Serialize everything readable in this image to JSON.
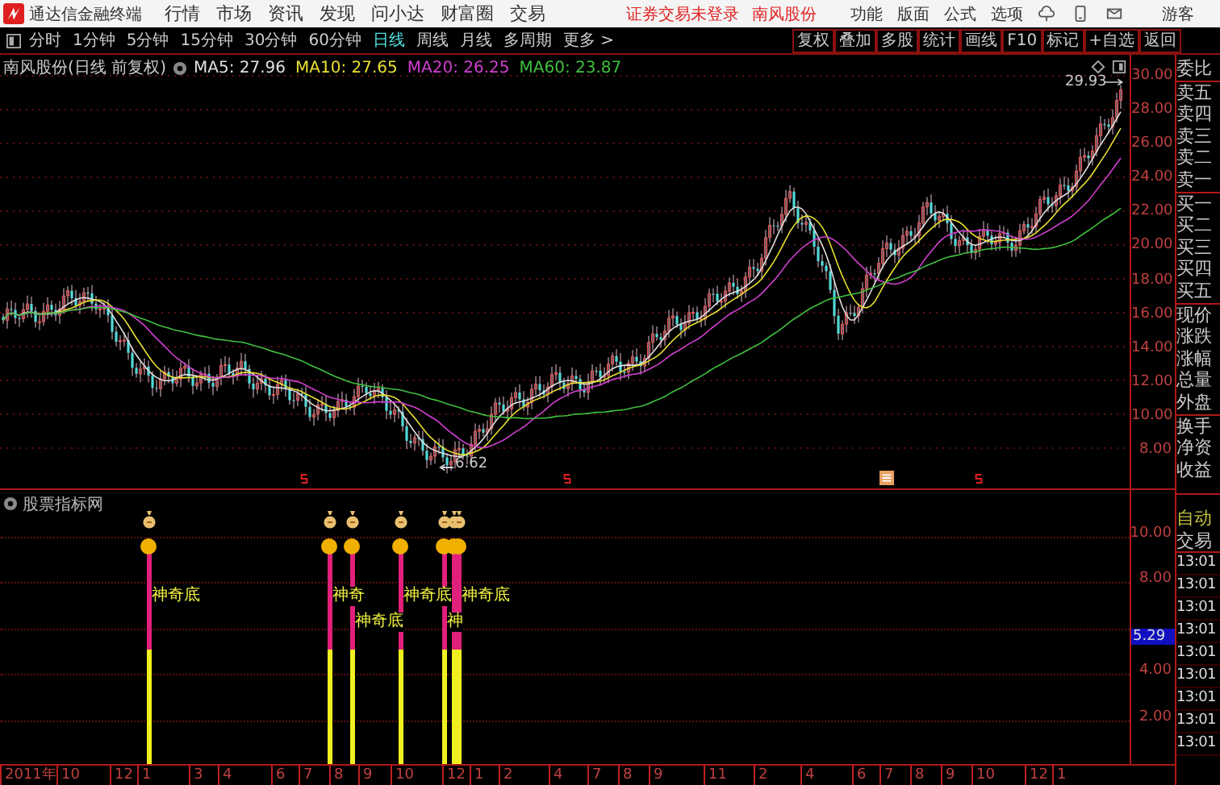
{
  "title_bar": {
    "app_name": "通达信金融终端",
    "menu": [
      "行情",
      "市场",
      "资讯",
      "发现",
      "问小达",
      "财富圈",
      "交易"
    ],
    "login_status": "证券交易未登录",
    "stock_name": "南风股份",
    "right_menu": [
      "功能",
      "版面",
      "公式",
      "选项"
    ],
    "user": "游客"
  },
  "toolbar": {
    "periods": [
      {
        "label": "分时",
        "selected": false
      },
      {
        "label": "1分钟",
        "selected": false
      },
      {
        "label": "5分钟",
        "selected": false
      },
      {
        "label": "15分钟",
        "selected": false
      },
      {
        "label": "30分钟",
        "selected": false
      },
      {
        "label": "60分钟",
        "selected": false
      },
      {
        "label": "日线",
        "selected": true
      },
      {
        "label": "周线",
        "selected": false
      },
      {
        "label": "月线",
        "selected": false
      },
      {
        "label": "多周期",
        "selected": false
      },
      {
        "label": "更多 >",
        "selected": false
      }
    ],
    "buttons": [
      "复权",
      "叠加",
      "多股",
      "统计",
      "画线",
      "F10",
      "标记",
      "+自选",
      "返回"
    ]
  },
  "main_chart": {
    "title": "南风股份(日线 前复权)",
    "ma": [
      {
        "label": "MA5: 27.96",
        "color": "#e0e0e0"
      },
      {
        "label": "MA10: 27.65",
        "color": "#e8e030"
      },
      {
        "label": "MA20: 26.25",
        "color": "#d040d0"
      },
      {
        "label": "MA60: 23.87",
        "color": "#40c040"
      }
    ],
    "price_axis": [
      "30.00",
      "28.00",
      "26.00",
      "24.00",
      "22.00",
      "20.00",
      "18.00",
      "16.00",
      "14.00",
      "12.00",
      "10.00",
      "8.00"
    ],
    "high_label": "29.93",
    "low_label": "6.62"
  },
  "indicator": {
    "name": "股票指标网",
    "signals": [
      {
        "kind": "labeled",
        "label": "神奇底"
      },
      {
        "kind": "labeled",
        "label": "神奇"
      },
      {
        "kind": "labeled",
        "label": "神奇底"
      },
      {
        "kind": "labeled",
        "label": "神奇底"
      },
      {
        "kind": "labeled",
        "label": "神"
      },
      {
        "kind": "plain"
      },
      {
        "kind": "labeled",
        "label": "神奇底"
      }
    ],
    "axis": [
      "10.00",
      "8.00",
      "4.00",
      "2.00"
    ],
    "current_value": "5.29"
  },
  "date_axis": [
    "2011年",
    "10",
    "12",
    "1",
    "3",
    "4",
    "6",
    "7",
    "8",
    "9",
    "10",
    "12",
    "1",
    "2",
    "4",
    "7",
    "8",
    "9",
    "11",
    "2",
    "4",
    "6",
    "7",
    "8",
    "9",
    "10",
    "12",
    "1"
  ],
  "side_panel": {
    "groups": [
      {
        "items": [
          "委比"
        ]
      },
      {
        "items": [
          "卖五",
          "卖四",
          "卖三",
          "卖二",
          "卖一"
        ]
      },
      {
        "items": [
          "买一",
          "买二",
          "买三",
          "买四",
          "买五"
        ]
      },
      {
        "items": [
          "现价",
          "涨跌",
          "涨幅",
          "总量",
          "外盘"
        ]
      },
      {
        "items": [
          "换手",
          "净资",
          "收益"
        ]
      }
    ],
    "auto_label": "自动",
    "trade_label": "交易",
    "times": [
      "13:01",
      "13:01",
      "13:01",
      "13:01",
      "13:01",
      "13:01",
      "13:01",
      "13:01",
      "13:01"
    ]
  }
}
